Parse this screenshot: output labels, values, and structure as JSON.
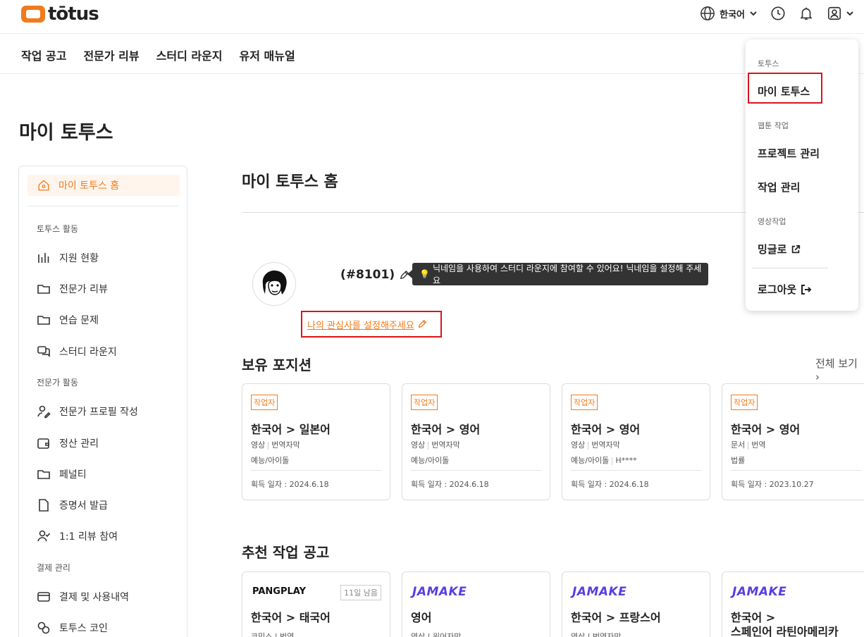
{
  "header": {
    "logo_text": "tōtus",
    "language": "한국어"
  },
  "nav": [
    "작업 공고",
    "전문가 리뷰",
    "스터디 라운지",
    "유저 매뉴얼"
  ],
  "page_title": "마이 토투스",
  "sidebar": {
    "home": "마이 토투스 홈",
    "groups": {
      "activity": "토투스 활동",
      "expert": "전문가 활동",
      "payment": "결제 관리"
    },
    "items": {
      "apply_status": "지원 현황",
      "expert_review": "전문가 리뷰",
      "practice": "연습 문제",
      "study_lounge": "스터디 라운지",
      "profile": "전문가 프로필 작성",
      "settlement": "정산 관리",
      "penalty": "페널티",
      "certificate": "증명서 발급",
      "one_on_one": "1:1 리뷰 참여",
      "payments": "결제 및 사용내역",
      "coin": "토투스 코인"
    }
  },
  "main": {
    "title": "마이 토투스 홈",
    "nickname": "(#8101)",
    "tooltip": "닉네임을 사용하여 스터디 라운지에 참여할 수 있어요!  닉네임을 설정해 주세요",
    "interest_link": "나의 관심사를 설정해주세요",
    "positions_title": "보유 포지션",
    "view_all": "전체 보기",
    "positions": [
      {
        "badge": "작업자",
        "from": "한국어",
        "to": "일본어",
        "type1": "영상",
        "type2": "번역자막",
        "genre": "예능/아이돌",
        "genre2": "",
        "date": "획득 일자 : 2024.6.18"
      },
      {
        "badge": "작업자",
        "from": "한국어",
        "to": "영어",
        "type1": "영상",
        "type2": "번역자막",
        "genre": "예능/아이돌",
        "genre2": "",
        "date": "획득 일자 : 2024.6.18"
      },
      {
        "badge": "작업자",
        "from": "한국어",
        "to": "영어",
        "type1": "영상",
        "type2": "번역자막",
        "genre": "예능/아이돌",
        "genre2": "H****",
        "date": "획득 일자 : 2024.6.18"
      },
      {
        "badge": "작업자",
        "from": "한국어",
        "to": "영어",
        "type1": "문서",
        "type2": "번역",
        "genre": "법률",
        "genre2": "",
        "date": "획득 일자 : 2023.10.27"
      }
    ],
    "recommend_title": "추천 작업 공고",
    "recommended": [
      {
        "brand": "PANGPLAY",
        "days": "11일 남음",
        "lang": "한국어 > 태국어",
        "meta": "코믹스 | 번역"
      },
      {
        "brand": "JAMAKE",
        "days": "",
        "lang": "영어",
        "meta": "영상 | 원어자막"
      },
      {
        "brand": "JAMAKE",
        "days": "",
        "lang": "한국어 > 프랑스어",
        "meta": "영상 | 번역자막"
      },
      {
        "brand": "JAMAKE",
        "days": "",
        "lang": "한국어 >",
        "lang2": "스페인어 라틴아메리카",
        "meta": ""
      }
    ]
  },
  "dropdown": {
    "group_totus": "토투스",
    "my_totus": "마이 토투스",
    "group_webtoon": "웹툰 작업",
    "project_manage": "프로젝트 관리",
    "task_manage": "작업 관리",
    "group_video": "영상작업",
    "minglo": "밍글로",
    "logout": "로그아웃"
  },
  "colors": {
    "accent": "#f07b1d",
    "highlight": "#d9141b",
    "jamake": "#5b3de0"
  }
}
